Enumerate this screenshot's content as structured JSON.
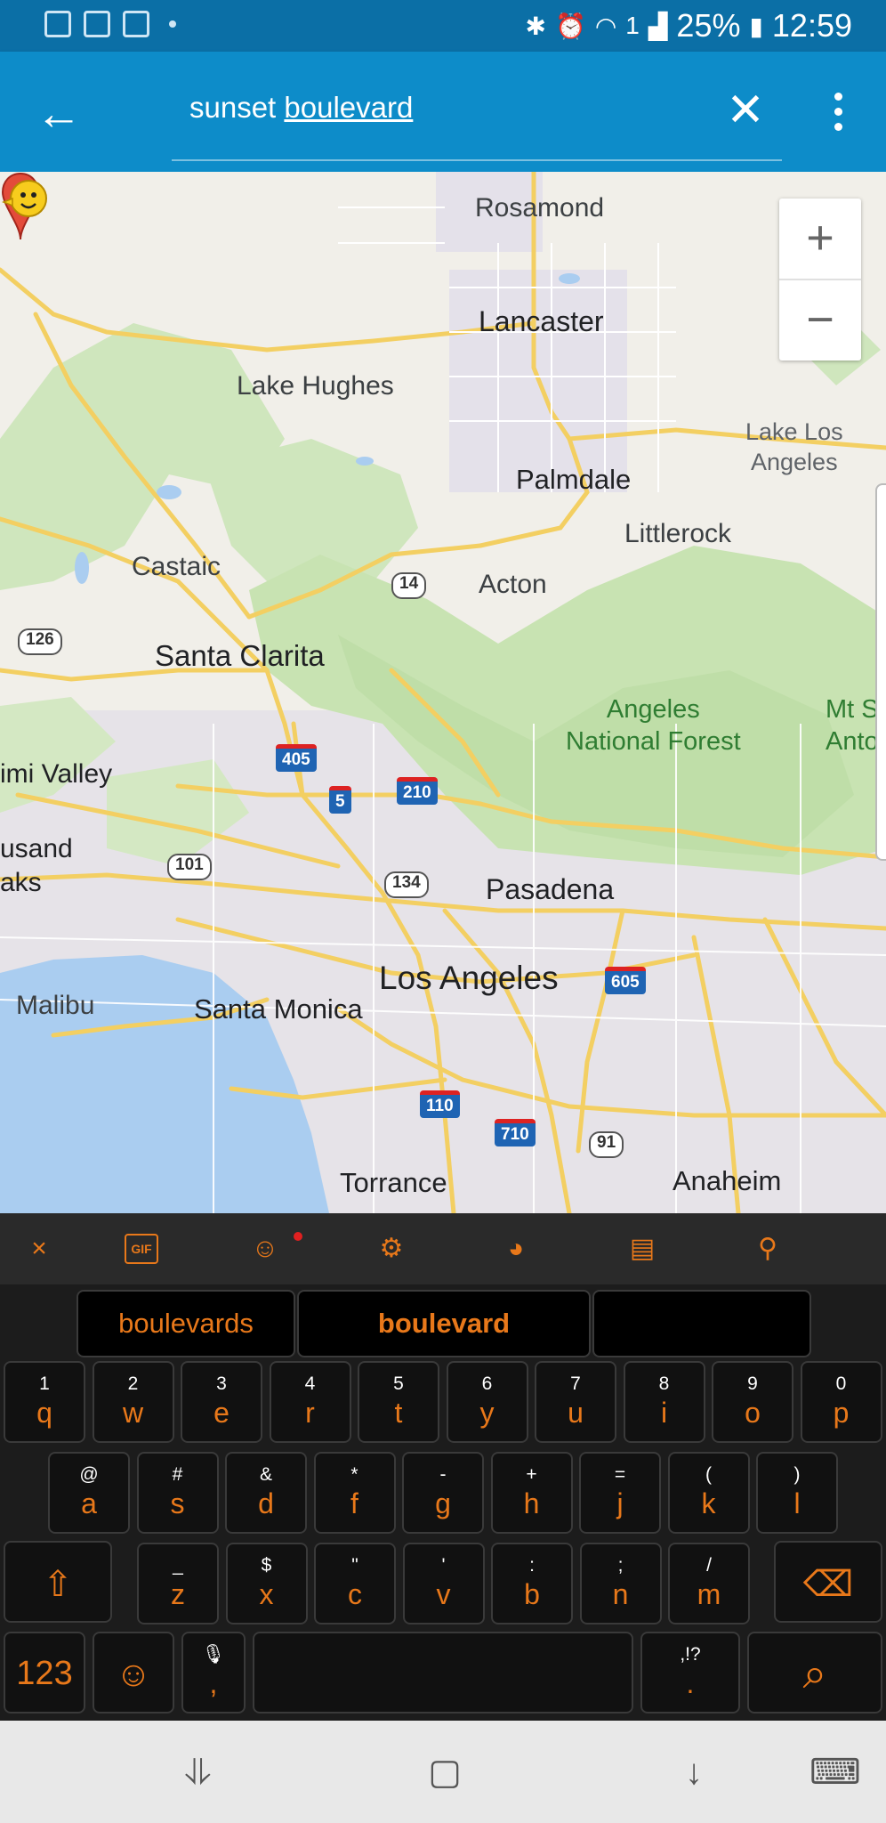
{
  "status_bar": {
    "battery": "25%",
    "time": "12:59",
    "sim_slot": "1"
  },
  "search": {
    "query_plain": "sunset ",
    "query_underlined": "boulevard"
  },
  "map": {
    "zoom_in": "+",
    "zoom_out": "−",
    "labels": {
      "rosamond": "Rosamond",
      "lancaster": "Lancaster",
      "lake_hughes": "Lake Hughes",
      "lake_los_angeles_1": "Lake Los",
      "lake_los_angeles_2": "Angeles",
      "palmdale": "Palmdale",
      "littlerock": "Littlerock",
      "castaic": "Castaic",
      "acton": "Acton",
      "santa_clarita": "Santa Clarita",
      "angeles_nf_1": "Angeles",
      "angeles_nf_2": "National Forest",
      "mt_1": "Mt S",
      "mt_2": "Anto",
      "simi_valley": "imi Valley",
      "thousand_1": "usand",
      "thousand_2": "aks",
      "pasadena": "Pasadena",
      "los_angeles": "Los Angeles",
      "malibu": "Malibu",
      "santa_monica": "Santa Monica",
      "torrance": "Torrance",
      "anaheim": "Anaheim"
    },
    "shields": {
      "r14": "14",
      "r126": "126",
      "i405": "405",
      "i5": "5",
      "i210": "210",
      "r101": "101",
      "r134": "134",
      "i605": "605",
      "i110": "110",
      "i710": "710",
      "r91": "91"
    }
  },
  "keyboard": {
    "toolbar": {
      "close": "×",
      "gif": "GIF"
    },
    "suggestions": [
      "boulevards",
      "boulevard",
      ""
    ],
    "row1": [
      {
        "alt": "1",
        "main": "q"
      },
      {
        "alt": "2",
        "main": "w"
      },
      {
        "alt": "3",
        "main": "e"
      },
      {
        "alt": "4",
        "main": "r"
      },
      {
        "alt": "5",
        "main": "t"
      },
      {
        "alt": "6",
        "main": "y"
      },
      {
        "alt": "7",
        "main": "u"
      },
      {
        "alt": "8",
        "main": "i"
      },
      {
        "alt": "9",
        "main": "o"
      },
      {
        "alt": "0",
        "main": "p"
      }
    ],
    "row2": [
      {
        "alt": "@",
        "main": "a"
      },
      {
        "alt": "#",
        "main": "s"
      },
      {
        "alt": "&",
        "main": "d"
      },
      {
        "alt": "*",
        "main": "f"
      },
      {
        "alt": "-",
        "main": "g"
      },
      {
        "alt": "+",
        "main": "h"
      },
      {
        "alt": "=",
        "main": "j"
      },
      {
        "alt": "(",
        "main": "k"
      },
      {
        "alt": ")",
        "main": "l"
      }
    ],
    "row3": [
      {
        "alt": "_",
        "main": "z"
      },
      {
        "alt": "$",
        "main": "x"
      },
      {
        "alt": "\"",
        "main": "c"
      },
      {
        "alt": "'",
        "main": "v"
      },
      {
        "alt": ":",
        "main": "b"
      },
      {
        "alt": ";",
        "main": "n"
      },
      {
        "alt": "/",
        "main": "m"
      }
    ],
    "sym_key": "123",
    "comma_key": ",",
    "period_alt": ",!?",
    "period_key": "."
  },
  "colors": {
    "appbar": "#0d8cc9",
    "status": "#0b6fa6",
    "key_accent": "#e8781a"
  }
}
